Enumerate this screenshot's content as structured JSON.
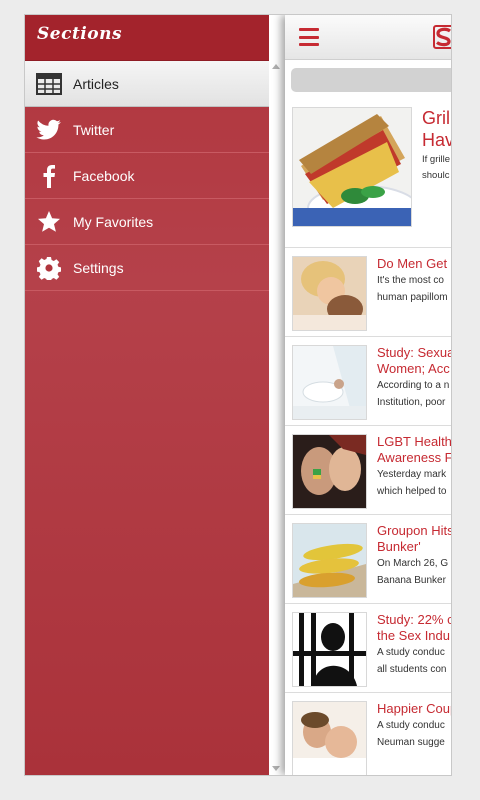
{
  "drawer": {
    "title": "Sections",
    "items": [
      {
        "label": "Articles",
        "icon": "newspaper-icon",
        "active": true
      },
      {
        "label": "Twitter",
        "icon": "twitter-bird-icon"
      },
      {
        "label": "Facebook",
        "icon": "facebook-f-icon"
      },
      {
        "label": "My Favorites",
        "icon": "star-icon"
      },
      {
        "label": "Settings",
        "icon": "gear-icon"
      }
    ]
  },
  "panel": {
    "menu_icon": "hamburger-menu-icon",
    "logo_icon": "app-logo-icon"
  },
  "articles": [
    {
      "title": "Gril",
      "title2": "Hav",
      "summary": "If grille",
      "summary2": "shoulc"
    },
    {
      "title": "Do Men Get",
      "summary": "It's the most co",
      "summary2": "human papillom"
    },
    {
      "title": "Study: Sexua",
      "title2": "Women; Acc",
      "summary": "According to a n",
      "summary2": "Institution, poor"
    },
    {
      "title": "LGBT Health",
      "title2": "Awareness F",
      "summary": "Yesterday mark",
      "summary2": "which helped to"
    },
    {
      "title": "Groupon Hits",
      "title2": "Bunker'",
      "summary": "On March 26, G",
      "summary2": "Banana Bunker"
    },
    {
      "title": "Study: 22% c",
      "title2": "the Sex Indu",
      "summary": "A study conduc",
      "summary2": "all students con"
    },
    {
      "title": "Happier Coup",
      "summary": "A study conduc",
      "summary2": "Neuman sugge"
    }
  ],
  "colors": {
    "accent": "#c62a32",
    "drawer_bg": "#b0353d",
    "drawer_header": "#a3232c"
  }
}
